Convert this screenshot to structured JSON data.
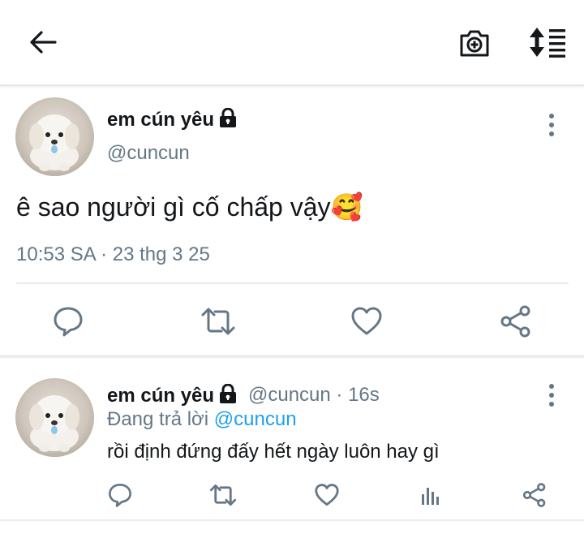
{
  "header": {
    "back_icon": "arrow-left-icon",
    "camera_icon": "add-photo-icon",
    "sort_icon": "sort-icon"
  },
  "main_tweet": {
    "display_name": "em cún yêu",
    "handle": "@cuncun",
    "text": "ê sao người gì cố chấp vậy",
    "emoji": "🥰",
    "timestamp": "10:53 SA · 23 thg 3 25",
    "actions": [
      "reply-icon",
      "retweet-icon",
      "like-icon",
      "share-icon"
    ]
  },
  "reply_tweet": {
    "display_name": "em cún yêu",
    "handle_time": "@cuncun · 16s",
    "replying_prefix": "Đang trả lời",
    "replying_handle": "@cuncun",
    "text": "rồi định đứng đấy hết ngày luôn hay gì",
    "actions": [
      "reply-icon",
      "retweet-icon",
      "like-icon",
      "analytics-icon",
      "share-icon"
    ]
  },
  "colors": {
    "text": "#14171a",
    "secondary": "#657786",
    "link": "#1da1f2",
    "divider": "#e6ecf0"
  }
}
